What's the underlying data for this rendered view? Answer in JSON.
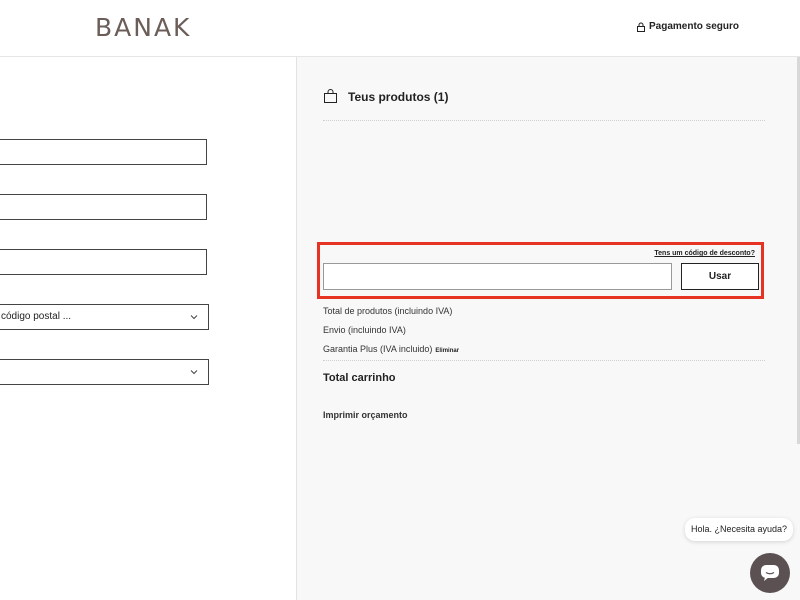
{
  "header": {
    "logo": "BANAK",
    "secure_payment": "Pagamento seguro",
    "secure_icon": "lock-icon"
  },
  "form": {
    "postal_select": "código postal ...",
    "chevron_icon": "chevron-down-icon"
  },
  "cart": {
    "title": "Teus produtos (1)",
    "bag_icon": "shopping-bag-icon",
    "discount_link": "Tens um código de desconto?",
    "discount_input_value": "",
    "use_button": "Usar",
    "total_products": "Total de produtos (incluindo IVA)",
    "shipping": "Envio (incluindo IVA)",
    "warranty": "Garantia Plus (IVA incluido)",
    "remove": "Eliminar",
    "total_cart": "Total carrinho",
    "print_quote": "Imprimir orçamento"
  },
  "chat": {
    "bubble": "Hola. ¿Necesita ayuda?",
    "icon": "chat-icon"
  },
  "colors": {
    "highlight": "#e63323",
    "logo": "#6b5d58",
    "chat_button": "#5b5153"
  }
}
